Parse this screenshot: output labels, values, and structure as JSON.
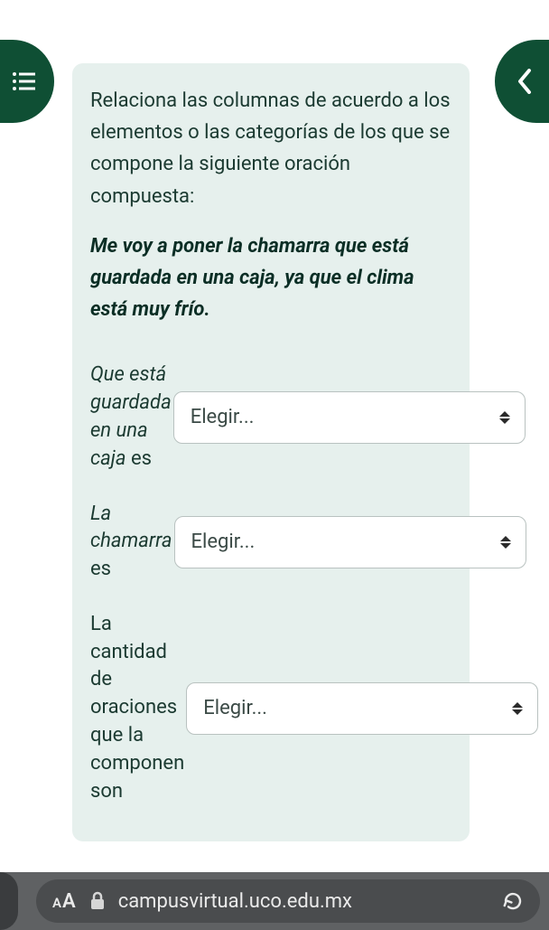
{
  "question": {
    "instructions": "Relaciona las columnas de acuerdo a los elementos o las categorías de los que se compone la siguiente oración compuesta:",
    "sentence": "Me voy a poner la chamarra que está guardada en una caja, ya que el clima está muy frío."
  },
  "rows": [
    {
      "italic": "Que está guardada en una caja",
      "tail": " es",
      "placeholder": "Elegir..."
    },
    {
      "italic": "La chamarra",
      "tail": " es",
      "placeholder": "Elegir..."
    },
    {
      "italic": "",
      "tail": "La cantidad de oraciones que la componen son",
      "placeholder": "Elegir..."
    }
  ],
  "browser": {
    "url": "campusvirtual.uco.edu.mx"
  }
}
